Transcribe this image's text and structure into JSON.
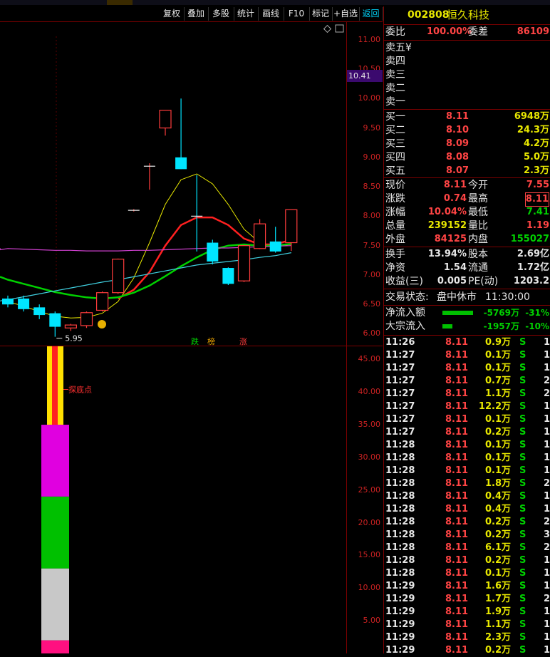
{
  "toolbar": {
    "buttons": [
      "复权",
      "叠加",
      "多股",
      "统计",
      "画线",
      "F10",
      "标记",
      "+自选",
      "返回"
    ]
  },
  "stock": {
    "code": "002808",
    "name": "恒久科技"
  },
  "orderbook": {
    "weibi_label": "委比",
    "weibi_value": "100.00%",
    "weicha_label": "委差",
    "weicha_value": "86109",
    "sells": [
      {
        "label": "卖五",
        "extra": "¥"
      },
      {
        "label": "卖四"
      },
      {
        "label": "卖三"
      },
      {
        "label": "卖二"
      },
      {
        "label": "卖一"
      }
    ],
    "buys": [
      {
        "label": "买一",
        "price": "8.11",
        "vol": "6948万"
      },
      {
        "label": "买二",
        "price": "8.10",
        "vol": "24.3万"
      },
      {
        "label": "买三",
        "price": "8.09",
        "vol": "4.2万"
      },
      {
        "label": "买四",
        "price": "8.08",
        "vol": "5.0万"
      },
      {
        "label": "买五",
        "price": "8.07",
        "vol": "2.3万"
      }
    ]
  },
  "quote": {
    "rows": [
      {
        "l1": "现价",
        "v1": "8.11",
        "l2": "今开",
        "v2": "7.55"
      },
      {
        "l1": "涨跌",
        "v1": "0.74",
        "l2": "最高",
        "v2": "8.11"
      },
      {
        "l1": "涨幅",
        "v1": "10.04%",
        "l2": "最低",
        "v2": "7.41"
      },
      {
        "l1": "总量",
        "v1": "239152",
        "l2": "量比",
        "v2": "1.19"
      },
      {
        "l1": "外盘",
        "v1": "84125",
        "l2": "内盘",
        "v2": "155027"
      }
    ],
    "rows2": [
      {
        "l1": "换手",
        "v1": "13.94%",
        "l2": "股本",
        "v2": "2.69亿"
      },
      {
        "l1": "净资",
        "v1": "1.54",
        "l2": "流通",
        "v2": "1.72亿"
      },
      {
        "l1": "收益(三)",
        "v1": "0.005",
        "l2": "PE(动)",
        "v2": "1203.2"
      }
    ]
  },
  "status": {
    "label": "交易状态:",
    "value": "盘中休市",
    "time": "11:30:00"
  },
  "flows": [
    {
      "label": "净流入额",
      "value": "-5769万",
      "pct": "-31%",
      "bar": 0.31
    },
    {
      "label": "大宗流入",
      "value": "-1957万",
      "pct": "-10%",
      "bar": 0.1
    }
  ],
  "trades": [
    {
      "time": "11:26",
      "price": "8.11",
      "vol": "0.9万",
      "side": "S",
      "n": "1"
    },
    {
      "time": "11:27",
      "price": "8.11",
      "vol": "0.1万",
      "side": "S",
      "n": "1"
    },
    {
      "time": "11:27",
      "price": "8.11",
      "vol": "0.1万",
      "side": "S",
      "n": "1"
    },
    {
      "time": "11:27",
      "price": "8.11",
      "vol": "0.7万",
      "side": "S",
      "n": "2"
    },
    {
      "time": "11:27",
      "price": "8.11",
      "vol": "1.1万",
      "side": "S",
      "n": "2"
    },
    {
      "time": "11:27",
      "price": "8.11",
      "vol": "12.2万",
      "side": "S",
      "n": "1"
    },
    {
      "time": "11:27",
      "price": "8.11",
      "vol": "0.1万",
      "side": "S",
      "n": "1"
    },
    {
      "time": "11:27",
      "price": "8.11",
      "vol": "0.2万",
      "side": "S",
      "n": "1"
    },
    {
      "time": "11:28",
      "price": "8.11",
      "vol": "0.1万",
      "side": "S",
      "n": "1"
    },
    {
      "time": "11:28",
      "price": "8.11",
      "vol": "0.1万",
      "side": "S",
      "n": "1"
    },
    {
      "time": "11:28",
      "price": "8.11",
      "vol": "0.1万",
      "side": "S",
      "n": "1"
    },
    {
      "time": "11:28",
      "price": "8.11",
      "vol": "1.8万",
      "side": "S",
      "n": "2"
    },
    {
      "time": "11:28",
      "price": "8.11",
      "vol": "0.4万",
      "side": "S",
      "n": "1"
    },
    {
      "time": "11:28",
      "price": "8.11",
      "vol": "0.4万",
      "side": "S",
      "n": "1"
    },
    {
      "time": "11:28",
      "price": "8.11",
      "vol": "0.2万",
      "side": "S",
      "n": "2"
    },
    {
      "time": "11:28",
      "price": "8.11",
      "vol": "0.2万",
      "side": "S",
      "n": "3"
    },
    {
      "time": "11:28",
      "price": "8.11",
      "vol": "6.1万",
      "side": "S",
      "n": "2"
    },
    {
      "time": "11:28",
      "price": "8.11",
      "vol": "0.2万",
      "side": "S",
      "n": "1"
    },
    {
      "time": "11:28",
      "price": "8.11",
      "vol": "0.1万",
      "side": "S",
      "n": "1"
    },
    {
      "time": "11:29",
      "price": "8.11",
      "vol": "1.6万",
      "side": "S",
      "n": "1"
    },
    {
      "time": "11:29",
      "price": "8.11",
      "vol": "1.7万",
      "side": "S",
      "n": "2"
    },
    {
      "time": "11:29",
      "price": "8.11",
      "vol": "1.9万",
      "side": "S",
      "n": "1"
    },
    {
      "time": "11:29",
      "price": "8.11",
      "vol": "1.1万",
      "side": "S",
      "n": "1"
    },
    {
      "time": "11:29",
      "price": "8.11",
      "vol": "2.3万",
      "side": "S",
      "n": "1"
    },
    {
      "time": "11:29",
      "price": "8.11",
      "vol": "0.2万",
      "side": "S",
      "n": "1"
    }
  ],
  "chart_main": {
    "y_ticks": [
      "11.00",
      "10.50",
      "10.00",
      "9.50",
      "9.00",
      "8.50",
      "8.00",
      "7.50",
      "7.00",
      "6.50",
      "6.00"
    ],
    "current_price_box": "10.41",
    "low_label": "5.95",
    "tags": [
      "跌",
      "榜",
      "涨"
    ]
  },
  "chart_sub": {
    "y_ticks": [
      "45.00",
      "40.00",
      "35.00",
      "30.00",
      "25.00",
      "20.00",
      "15.00",
      "10.00",
      "5.00"
    ],
    "annotation": "探底点"
  },
  "colors": {
    "up": "#ff3c3c",
    "down": "#00e5ff",
    "ma5": "#e8e800",
    "ma10": "#ff2020",
    "ma20": "#00d000",
    "ma30": "#40d0e0",
    "ma60": "#d040d0",
    "frame": "#7a0000"
  },
  "chart_data": [
    {
      "type": "candlestick",
      "ylim": [
        5.8,
        11.3
      ],
      "candles": [
        {
          "o": 6.6,
          "c": 6.5,
          "h": 6.65,
          "l": 6.45
        },
        {
          "o": 6.6,
          "c": 6.42,
          "h": 6.65,
          "l": 6.38
        },
        {
          "o": 6.45,
          "c": 6.32,
          "h": 6.5,
          "l": 6.25
        },
        {
          "o": 6.35,
          "c": 6.12,
          "h": 6.38,
          "l": 5.95
        },
        {
          "o": 6.1,
          "c": 6.15,
          "h": 6.17,
          "l": 6.05
        },
        {
          "o": 6.14,
          "c": 6.36,
          "h": 6.38,
          "l": 6.1
        },
        {
          "o": 6.4,
          "c": 6.7,
          "h": 6.72,
          "l": 6.38
        },
        {
          "o": 6.7,
          "c": 7.27,
          "h": 7.28,
          "l": 6.68
        },
        {
          "o": 8.1,
          "c": 8.1,
          "h": 8.12,
          "l": 8.08
        },
        {
          "o": 8.85,
          "c": 8.85,
          "h": 8.9,
          "l": 8.45
        },
        {
          "o": 9.5,
          "c": 9.8,
          "h": 9.8,
          "l": 9.37
        },
        {
          "o": 9.0,
          "c": 8.8,
          "h": 10.0,
          "l": 8.8
        },
        {
          "o": 8.0,
          "c": 7.98,
          "h": 8.7,
          "l": 7.4
        },
        {
          "o": 7.55,
          "c": 7.23,
          "h": 7.6,
          "l": 7.18
        },
        {
          "o": 7.12,
          "c": 6.85,
          "h": 7.13,
          "l": 6.83
        },
        {
          "o": 6.9,
          "c": 7.5,
          "h": 7.51,
          "l": 6.88
        },
        {
          "o": 7.45,
          "c": 7.87,
          "h": 7.95,
          "l": 7.44
        },
        {
          "o": 7.57,
          "c": 7.4,
          "h": 7.82,
          "l": 7.38
        },
        {
          "o": 7.55,
          "c": 8.11,
          "h": 8.11,
          "l": 7.41
        }
      ],
      "series": [
        {
          "values": [
            6.55,
            6.47,
            6.38,
            6.3,
            6.27,
            6.28,
            6.35,
            6.55,
            6.95,
            7.55,
            8.2,
            8.62,
            8.72,
            8.55,
            8.2,
            7.78,
            7.55,
            7.48,
            7.52
          ]
        },
        {
          "values": [
            null,
            null,
            null,
            null,
            null,
            null,
            null,
            6.6,
            6.75,
            7.05,
            7.5,
            7.85,
            7.98,
            7.98,
            7.85,
            7.62,
            7.52,
            7.52,
            7.6
          ]
        },
        {
          "values": [
            6.92,
            6.85,
            6.78,
            6.71,
            6.66,
            6.62,
            6.6,
            6.62,
            6.7,
            6.82,
            6.98,
            7.15,
            7.3,
            7.43,
            7.5,
            7.52,
            7.5,
            7.5,
            7.53
          ]
        },
        {
          "values": [
            6.58,
            6.63,
            6.68,
            6.73,
            6.78,
            6.83,
            6.88,
            6.92,
            6.97,
            7.02,
            7.07,
            7.12,
            7.17,
            7.2,
            7.23,
            7.26,
            7.3,
            7.33,
            7.38
          ]
        },
        {
          "values": [
            7.45,
            7.44,
            7.43,
            7.42,
            7.42,
            7.41,
            7.41,
            7.41,
            7.42,
            7.42,
            7.43,
            7.44,
            7.45,
            7.46,
            7.46,
            7.47,
            7.48,
            7.49,
            7.5
          ]
        }
      ]
    },
    {
      "type": "bar",
      "ylim": [
        0,
        47
      ],
      "segments": [
        {
          "from": 35,
          "to": 47,
          "color": "#ffe000"
        },
        {
          "from": 24,
          "to": 35,
          "color": "#e000e0"
        },
        {
          "from": 13,
          "to": 24,
          "color": "#00c000"
        },
        {
          "from": 2,
          "to": 13,
          "color": "#c8c8c8"
        },
        {
          "from": 0,
          "to": 2,
          "color": "#ff1080"
        }
      ]
    }
  ]
}
